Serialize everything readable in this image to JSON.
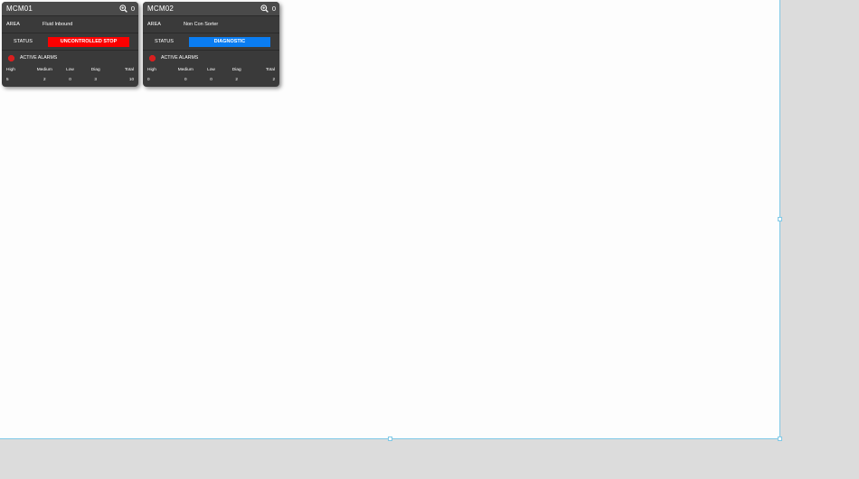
{
  "cards": [
    {
      "title": "MCM01",
      "zoom_icon": "zoom-in-icon",
      "count": "0",
      "area_label": "AREA",
      "area_value": "Fluid Inbound",
      "status_label": "STATUS",
      "status_value": "UNCONTROLLED STOP",
      "status_color": "#fb0000",
      "status_text_color": "#ffffff",
      "alarms_icon": "alarm-icon",
      "alarms_icon_color": "#d81f1f",
      "alarms_label": "ACTIVE ALARMS",
      "columns": [
        "High",
        "Medium",
        "Low",
        "Diag",
        "Total"
      ],
      "values": [
        "5",
        "2",
        "0",
        "3",
        "10"
      ]
    },
    {
      "title": "MCM02",
      "zoom_icon": "zoom-in-icon",
      "count": "0",
      "area_label": "AREA",
      "area_value": "Non Con Sorter",
      "status_label": "STATUS",
      "status_value": "DIAGNOSTIC",
      "status_color": "#0a7df2",
      "status_text_color": "#ffffff",
      "alarms_icon": "alarm-icon",
      "alarms_icon_color": "#d81f1f",
      "alarms_label": "ACTIVE ALARMS",
      "columns": [
        "High",
        "Medium",
        "Low",
        "Diag",
        "Total"
      ],
      "values": [
        "0",
        "0",
        "0",
        "2",
        "2"
      ]
    }
  ],
  "colors": {
    "card_bg": "#3a3a3a",
    "canvas_bg": "#fdfdfd",
    "workspace_bg": "#dcdcdc",
    "selection": "#7fc8e6"
  }
}
